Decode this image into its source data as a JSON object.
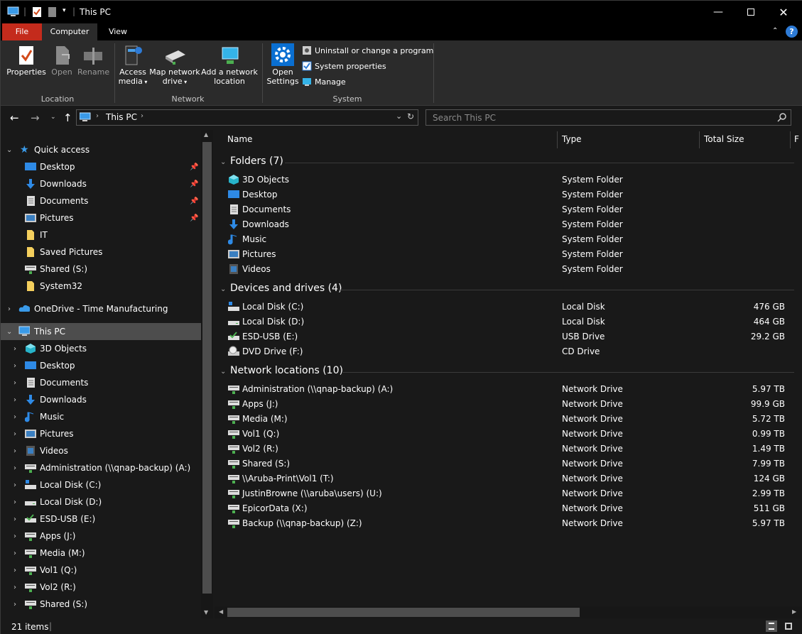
{
  "window": {
    "title": "This PC"
  },
  "ribbon_tabs": [
    "File",
    "Computer",
    "View"
  ],
  "ribbon": {
    "location": {
      "label": "Location",
      "properties": "Properties",
      "open": "Open",
      "rename": "Rename"
    },
    "network": {
      "label": "Network",
      "access_media_1": "Access",
      "access_media_2": "media",
      "map_drive_1": "Map network",
      "map_drive_2": "drive",
      "add_loc_1": "Add a network",
      "add_loc_2": "location"
    },
    "system": {
      "label": "System",
      "open_settings_1": "Open",
      "open_settings_2": "Settings",
      "uninstall": "Uninstall or change a program",
      "sys_props": "System properties",
      "manage": "Manage"
    }
  },
  "address": {
    "path": "This PC",
    "search_placeholder": "Search This PC"
  },
  "nav": {
    "quick_access": "Quick access",
    "quick_items": [
      "Desktop",
      "Downloads",
      "Documents",
      "Pictures",
      "IT",
      "Saved Pictures",
      "Shared (S:)",
      "System32"
    ],
    "onedrive": "OneDrive - Time Manufacturing",
    "this_pc": "This PC",
    "pc_items": [
      "3D Objects",
      "Desktop",
      "Documents",
      "Downloads",
      "Music",
      "Pictures",
      "Videos",
      "Administration (\\\\qnap-backup) (A:)",
      "Local Disk (C:)",
      "Local Disk (D:)",
      "ESD-USB (E:)",
      "Apps (J:)",
      "Media (M:)",
      "Vol1 (Q:)",
      "Vol2 (R:)",
      "Shared (S:)"
    ]
  },
  "columns": {
    "name": "Name",
    "type": "Type",
    "size": "Total Size",
    "extra": "F"
  },
  "groups": {
    "folders": "Folders (7)",
    "devices": "Devices and drives (4)",
    "network": "Network locations (10)"
  },
  "folders": [
    {
      "name": "3D Objects",
      "type": "System Folder",
      "icon": "3d-objects-icon"
    },
    {
      "name": "Desktop",
      "type": "System Folder",
      "icon": "desktop-icon"
    },
    {
      "name": "Documents",
      "type": "System Folder",
      "icon": "documents-icon"
    },
    {
      "name": "Downloads",
      "type": "System Folder",
      "icon": "downloads-icon"
    },
    {
      "name": "Music",
      "type": "System Folder",
      "icon": "music-icon"
    },
    {
      "name": "Pictures",
      "type": "System Folder",
      "icon": "pictures-icon"
    },
    {
      "name": "Videos",
      "type": "System Folder",
      "icon": "videos-icon"
    }
  ],
  "devices": [
    {
      "name": "Local Disk (C:)",
      "type": "Local Disk",
      "size": "476 GB",
      "icon": "windows-drive-icon"
    },
    {
      "name": "Local Disk (D:)",
      "type": "Local Disk",
      "size": "464 GB",
      "icon": "drive-icon"
    },
    {
      "name": "ESD-USB (E:)",
      "type": "USB Drive",
      "size": "29.2 GB",
      "icon": "usb-drive-icon"
    },
    {
      "name": "DVD Drive (F:)",
      "type": "CD Drive",
      "size": "",
      "icon": "dvd-drive-icon"
    }
  ],
  "network": [
    {
      "name": "Administration (\\\\qnap-backup) (A:)",
      "type": "Network Drive",
      "size": "5.97 TB"
    },
    {
      "name": "Apps (J:)",
      "type": "Network Drive",
      "size": "99.9 GB"
    },
    {
      "name": "Media (M:)",
      "type": "Network Drive",
      "size": "5.72 TB"
    },
    {
      "name": "Vol1 (Q:)",
      "type": "Network Drive",
      "size": "0.99 TB"
    },
    {
      "name": "Vol2 (R:)",
      "type": "Network Drive",
      "size": "1.49 TB"
    },
    {
      "name": "Shared (S:)",
      "type": "Network Drive",
      "size": "7.99 TB"
    },
    {
      "name": "\\\\Aruba-Print\\Vol1 (T:)",
      "type": "Network Drive",
      "size": "124 GB"
    },
    {
      "name": "JustinBrowne (\\\\aruba\\users) (U:)",
      "type": "Network Drive",
      "size": "2.99 TB"
    },
    {
      "name": "EpicorData (X:)",
      "type": "Network Drive",
      "size": "511 GB"
    },
    {
      "name": "Backup (\\\\qnap-backup) (Z:)",
      "type": "Network Drive",
      "size": "5.97 TB"
    }
  ],
  "status": {
    "items": "21 items"
  }
}
